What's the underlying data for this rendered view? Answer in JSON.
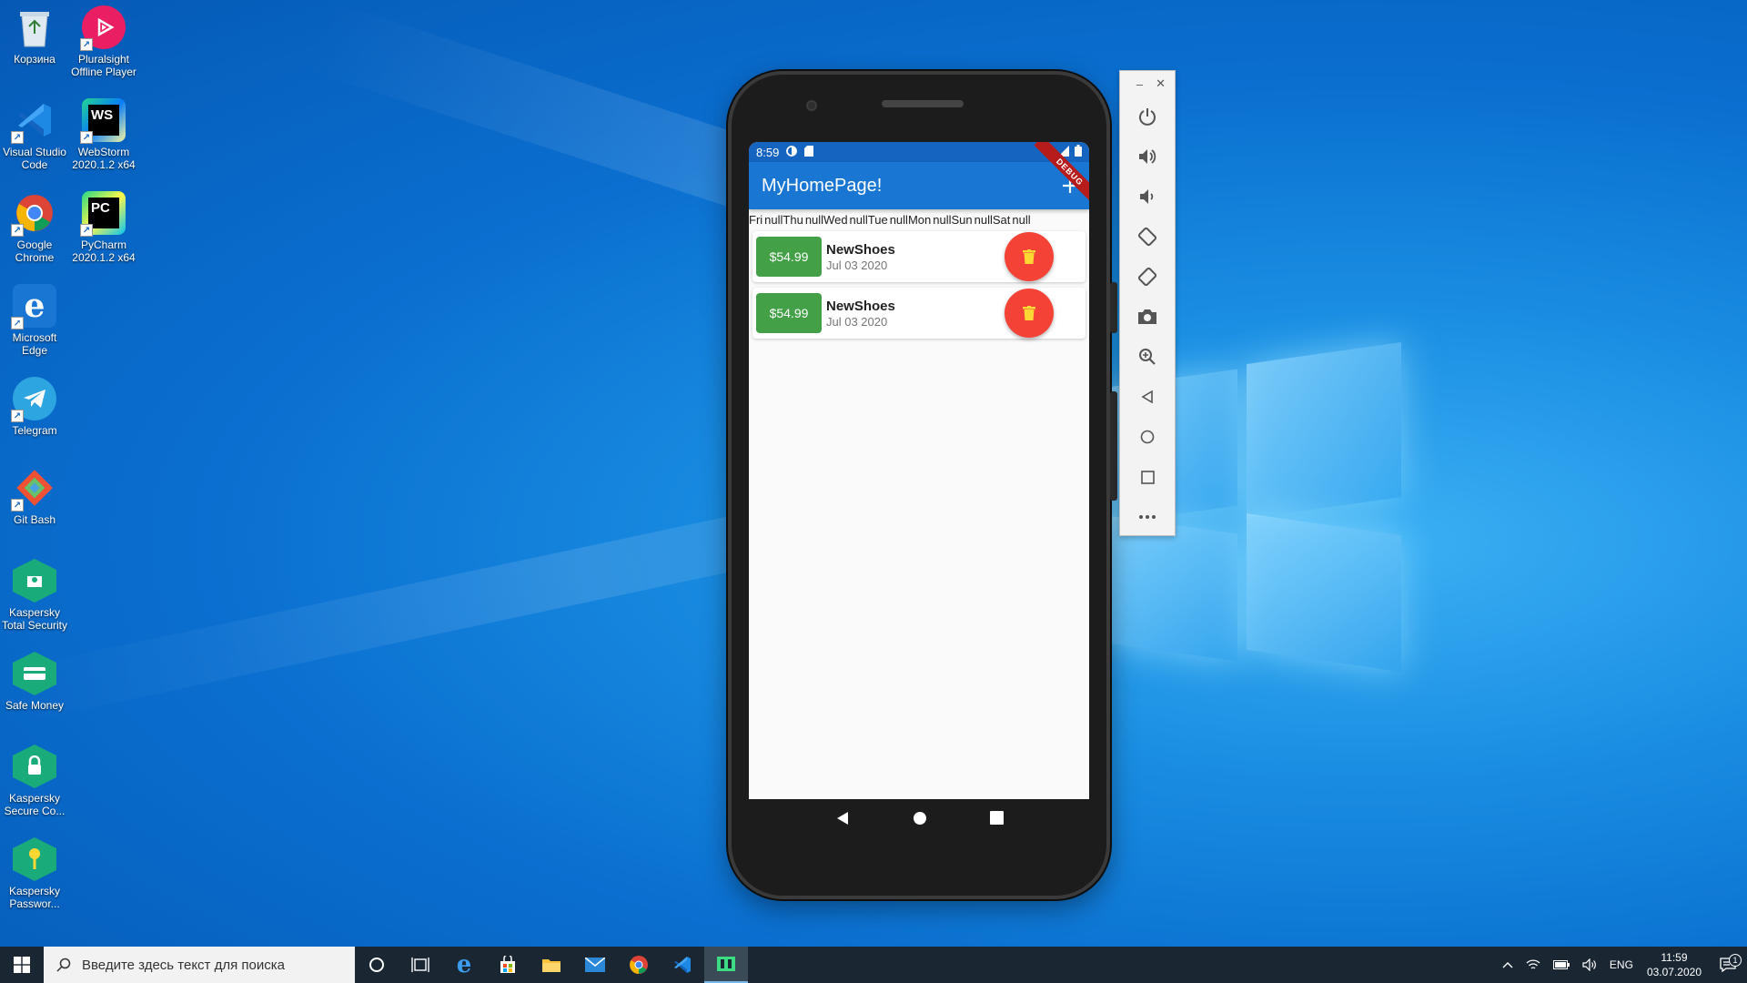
{
  "desktop": {
    "icons": [
      {
        "label": "Корзина",
        "icon": "recycle-bin-icon"
      },
      {
        "label": "Pluralsight Offline Player",
        "icon": "pluralsight-icon"
      },
      {
        "label": "Visual Studio Code",
        "icon": "vscode-icon"
      },
      {
        "label": "WebStorm 2020.1.2 x64",
        "icon": "webstorm-icon",
        "glyph": "WS"
      },
      {
        "label": "Google Chrome",
        "icon": "chrome-icon"
      },
      {
        "label": "PyCharm 2020.1.2 x64",
        "icon": "pycharm-icon",
        "glyph": "PC"
      },
      {
        "label": "Microsoft Edge",
        "icon": "edge-icon",
        "glyph": "e"
      },
      {
        "label": "Telegram",
        "icon": "telegram-icon"
      },
      {
        "label": "Git Bash",
        "icon": "git-bash-icon"
      },
      {
        "label": "Kaspersky Total Security",
        "icon": "kaspersky-total-security-icon"
      },
      {
        "label": "Safe Money",
        "icon": "safe-money-icon"
      },
      {
        "label": "Kaspersky Secure Co...",
        "icon": "kaspersky-secure-connection-icon"
      },
      {
        "label": "Kaspersky Passwor...",
        "icon": "kaspersky-password-icon"
      }
    ]
  },
  "phone": {
    "status_time": "8:59",
    "app_title": "MyHomePage!",
    "debug_banner": "DEBUG",
    "days_row": [
      "Fri",
      "nullThu",
      "nullWed",
      "nullTue",
      "nullMon",
      "nullSun",
      "nullSat",
      "null"
    ],
    "transactions": [
      {
        "price": "$54.99",
        "title": "NewShoes",
        "date": "Jul 03 2020"
      },
      {
        "price": "$54.99",
        "title": "NewShoes",
        "date": "Jul 03 2020"
      }
    ]
  },
  "emulator_toolbar": {
    "buttons": [
      "power-icon",
      "volume-up-icon",
      "volume-down-icon",
      "rotate-left-icon",
      "rotate-right-icon",
      "camera-icon",
      "zoom-icon",
      "back-icon",
      "home-icon",
      "overview-icon",
      "more-icon"
    ]
  },
  "taskbar": {
    "search_placeholder": "Введите здесь текст для поиска",
    "language": "ENG",
    "time": "11:59",
    "date": "03.07.2020",
    "notification_count": "1"
  },
  "colors": {
    "appbar": "#1976d2",
    "price_badge": "#43a047",
    "delete_button": "#f44336"
  }
}
